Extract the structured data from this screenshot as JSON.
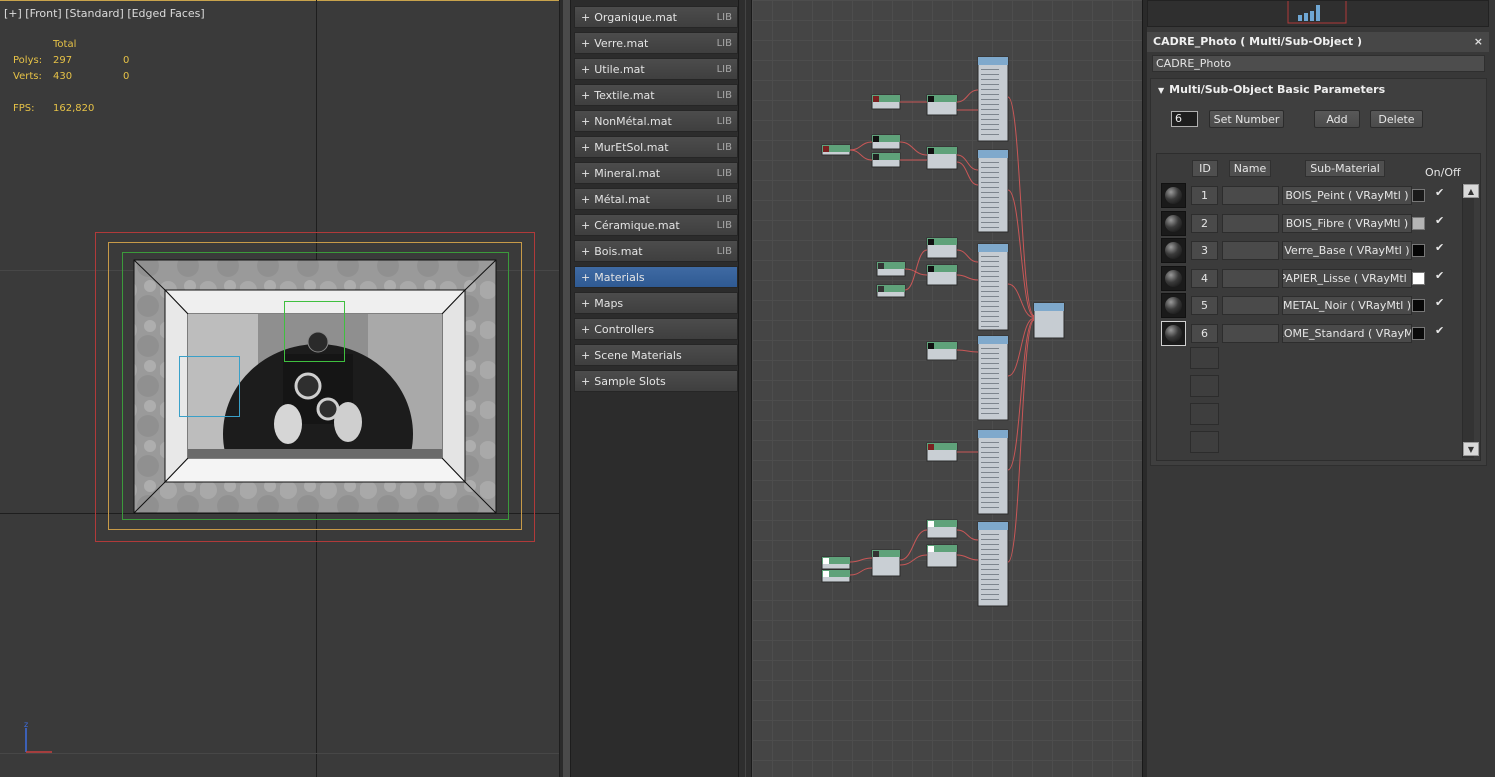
{
  "viewport": {
    "label": "[+] [Front] [Standard] [Edged Faces]",
    "stats": {
      "total_label": "Total",
      "polys_label": "Polys:",
      "polys_total": "297",
      "polys_sel": "0",
      "verts_label": "Verts:",
      "verts_total": "430",
      "verts_sel": "0",
      "fps_label": "FPS:",
      "fps_value": "162,820"
    },
    "axis": {
      "z": "z"
    }
  },
  "material_browser": {
    "groups": [
      {
        "label": "Organique.mat",
        "tag": "LIB"
      },
      {
        "label": "Verre.mat",
        "tag": "LIB"
      },
      {
        "label": "Utile.mat",
        "tag": "LIB"
      },
      {
        "label": "Textile.mat",
        "tag": "LIB"
      },
      {
        "label": "NonMétal.mat",
        "tag": "LIB"
      },
      {
        "label": "MurEtSol.mat",
        "tag": "LIB"
      },
      {
        "label": "Mineral.mat",
        "tag": "LIB"
      },
      {
        "label": "Métal.mat",
        "tag": "LIB"
      },
      {
        "label": "Céramique.mat",
        "tag": "LIB"
      },
      {
        "label": "Bois.mat",
        "tag": "LIB"
      },
      {
        "label": "Materials",
        "tag": ""
      },
      {
        "label": "Maps",
        "tag": ""
      },
      {
        "label": "Controllers",
        "tag": ""
      },
      {
        "label": "Scene Materials",
        "tag": ""
      },
      {
        "label": "Sample Slots",
        "tag": ""
      }
    ],
    "active_group": "Materials",
    "expand_glyph": "+"
  },
  "param_editor": {
    "title": "CADRE_Photo  ( Multi/Sub-Object )",
    "close_glyph": "×",
    "material_name": "CADRE_Photo",
    "rollout": {
      "title": "Multi/Sub-Object Basic Parameters",
      "collapse_glyph": "▼",
      "count": "6",
      "set_number": "Set Number",
      "add": "Add",
      "delete": "Delete",
      "headers": {
        "id": "ID",
        "name": "Name",
        "sub": "Sub-Material",
        "onoff": "On/Off"
      },
      "rows": [
        {
          "id": "1",
          "name": "",
          "sub": "BOIS_Peint  ( VRayMtl )",
          "color": "#1a1a1a",
          "on": "✔"
        },
        {
          "id": "2",
          "name": "",
          "sub": "BOIS_Fibre  ( VRayMtl )",
          "color": "#b4b4b4",
          "on": "✔"
        },
        {
          "id": "3",
          "name": "",
          "sub": "Verre_Base  ( VRayMtl )",
          "color": "#050505",
          "on": "✔"
        },
        {
          "id": "4",
          "name": "",
          "sub": "PAPIER_Lisse  ( VRayMtl )",
          "color": "#ffffff",
          "on": "✔"
        },
        {
          "id": "5",
          "name": "",
          "sub": "METAL_Noir  ( VRayMtl )",
          "color": "#070707",
          "on": "✔"
        },
        {
          "id": "6",
          "name": "",
          "sub": "ROME_Standard  ( VRayMt",
          "color": "#0a0a0a",
          "on": "✔"
        }
      ],
      "scroll_up": "▲",
      "scroll_down": "▼"
    }
  },
  "colors": {
    "accent_blue": "#2f5a93",
    "stats_yellow": "#e6c247",
    "node_header": "#7fa9cc",
    "map_node_header": "#5fa27a",
    "wire": "#e05a5a"
  }
}
